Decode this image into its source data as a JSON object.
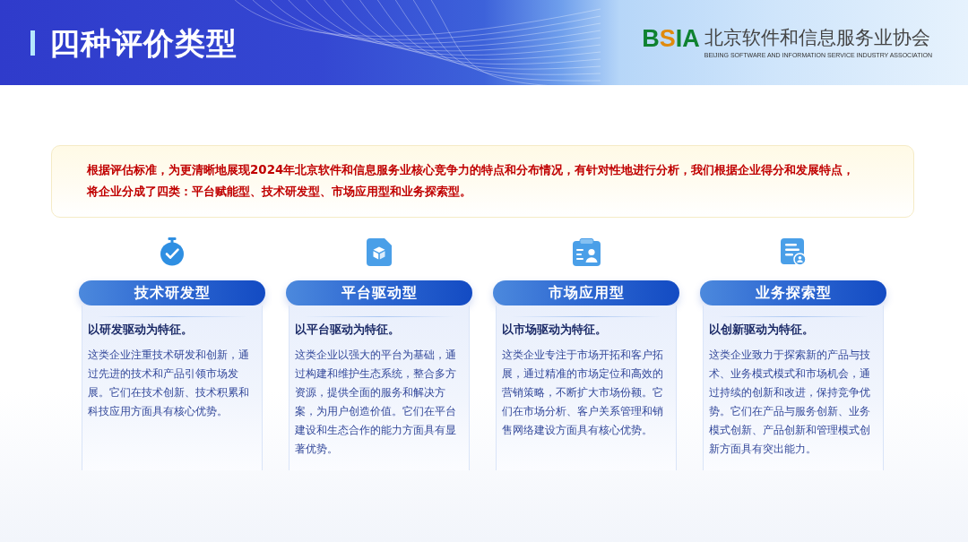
{
  "header": {
    "title": "四种评价类型",
    "logo": {
      "mark": "BSIA",
      "name": "北京软件和信息服务业协会",
      "name_en": "BEIJING SOFTWARE AND INFORMATION SERVICE INDUSTRY ASSOCIATION"
    }
  },
  "intro": "根据评估标准，为更清晰地展现2024年北京软件和信息服务业核心竞争力的特点和分布情况，有针对性地进行分析，我们根据企业得分和发展特点，将企业分成了四类：平台赋能型、技术研发型、市场应用型和业务探索型。",
  "categories": [
    {
      "kind": "stopwatch",
      "title": "技术研发型",
      "tagline": "以研发驱动为特征。",
      "description": "这类企业注重技术研发和创新，通过先进的技术和产品引领市场发展。它们在技术创新、技术积累和科技应用方面具有核心优势。"
    },
    {
      "kind": "cube",
      "title": "平台驱动型",
      "tagline": "以平台驱动为特征。",
      "description": "这类企业以强大的平台为基础，通过构建和维护生态系统，整合多方资源，提供全面的服务和解决方案，为用户创造价值。它们在平台建设和生态合作的能力方面具有显著优势。"
    },
    {
      "kind": "clipboard",
      "title": "市场应用型",
      "tagline": "以市场驱动为特征。",
      "description": "这类企业专注于市场开拓和客户拓展，通过精准的市场定位和高效的营销策略，不断扩大市场份额。它们在市场分析、客户关系管理和销售网络建设方面具有核心优势。"
    },
    {
      "kind": "document",
      "title": "业务探索型",
      "tagline": "以创新驱动为特征。",
      "description": "这类企业致力于探索新的产品与技术、业务模式模式和市场机会，通过持续的创新和改进，保持竞争优势。它们在产品与服务创新、业务模式创新、产品创新和管理模式创新方面具有突出能力。"
    }
  ]
}
